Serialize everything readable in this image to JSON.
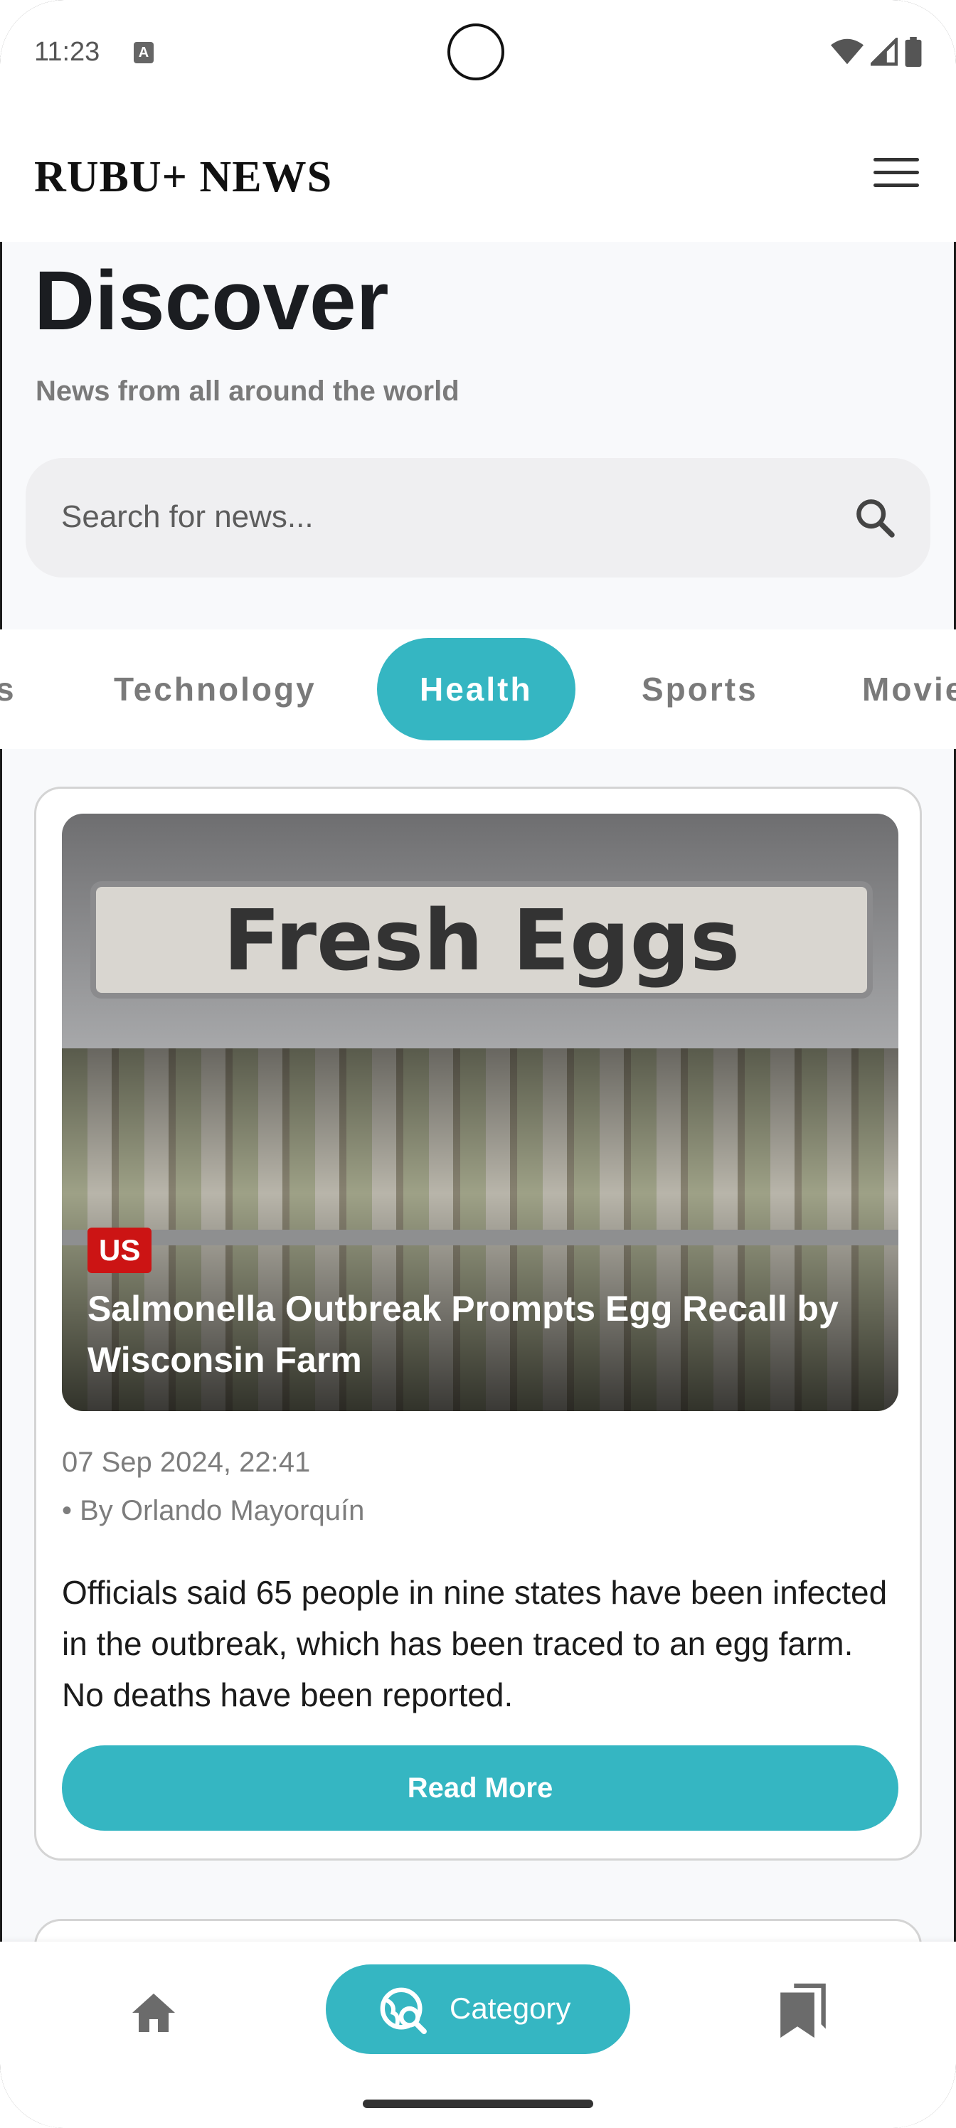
{
  "status_bar": {
    "time": "11:23",
    "notification_icon": "a-icon"
  },
  "header": {
    "brand": "RUBU+ NEWS",
    "menu_icon": "hamburger-menu-icon"
  },
  "discover": {
    "title": "Discover",
    "subtitle": "News from all around the world"
  },
  "search": {
    "placeholder": "Search for news..."
  },
  "tabs": [
    {
      "label": "s"
    },
    {
      "label": "Technology"
    },
    {
      "label": "Health",
      "active": true
    },
    {
      "label": "Sports"
    },
    {
      "label": "Movie"
    }
  ],
  "article": {
    "image_sign_text": "Fresh Eggs",
    "badge": "US",
    "headline": "Salmonella Outbreak Prompts Egg Recall by Wisconsin Farm",
    "date": "07 Sep 2024, 22:41",
    "author": "• By Orlando Mayorquín",
    "description": "Officials said 65 people in nine states have been infected in the outbreak, which has been traced to an egg farm. No deaths have been reported.",
    "read_more": "Read More"
  },
  "bottom_nav": {
    "home_icon": "home-icon",
    "category_label": "Category",
    "saved_icon": "bookmarks-icon"
  },
  "colors": {
    "accent": "#35b6c2",
    "badge": "#cc1414"
  }
}
